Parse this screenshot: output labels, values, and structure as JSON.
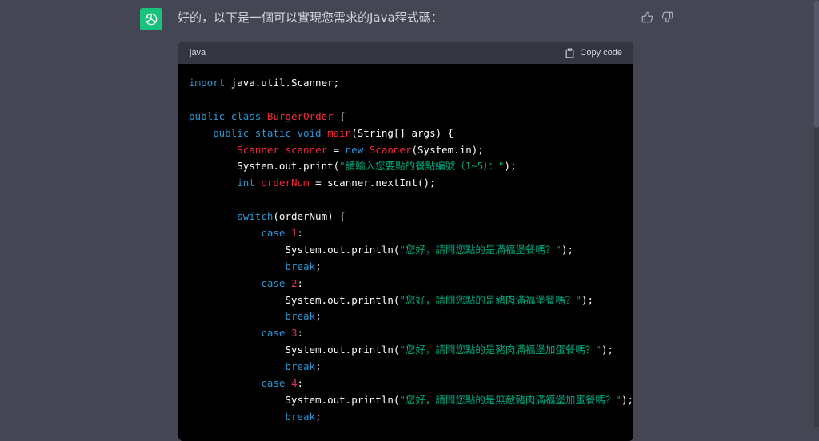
{
  "message": {
    "text": "好的，以下是一個可以實現您需求的Java程式碼："
  },
  "code_block": {
    "language": "java",
    "copy_label": "Copy code",
    "lines": [
      [
        {
          "t": "import",
          "c": "kw"
        },
        {
          "t": " java.util.Scanner;",
          "c": ""
        }
      ],
      [],
      [
        {
          "t": "public",
          "c": "kw"
        },
        {
          "t": " ",
          "c": ""
        },
        {
          "t": "class",
          "c": "kw"
        },
        {
          "t": " ",
          "c": ""
        },
        {
          "t": "BurgerOrder",
          "c": "cls"
        },
        {
          "t": " {",
          "c": ""
        }
      ],
      [
        {
          "t": "    ",
          "c": ""
        },
        {
          "t": "public",
          "c": "kw"
        },
        {
          "t": " ",
          "c": ""
        },
        {
          "t": "static",
          "c": "kw"
        },
        {
          "t": " ",
          "c": ""
        },
        {
          "t": "void",
          "c": "kw"
        },
        {
          "t": " ",
          "c": ""
        },
        {
          "t": "main",
          "c": "fn"
        },
        {
          "t": "(String[] args) {",
          "c": ""
        }
      ],
      [
        {
          "t": "        ",
          "c": ""
        },
        {
          "t": "Scanner",
          "c": "cls"
        },
        {
          "t": " ",
          "c": ""
        },
        {
          "t": "scanner",
          "c": "cls"
        },
        {
          "t": " = ",
          "c": ""
        },
        {
          "t": "new",
          "c": "kw"
        },
        {
          "t": " ",
          "c": ""
        },
        {
          "t": "Scanner",
          "c": "cls"
        },
        {
          "t": "(System.in);",
          "c": ""
        }
      ],
      [
        {
          "t": "        System.out.print(",
          "c": ""
        },
        {
          "t": "\"請輸入您要點的餐點編號（1~5）：\"",
          "c": "str"
        },
        {
          "t": ");",
          "c": ""
        }
      ],
      [
        {
          "t": "        ",
          "c": ""
        },
        {
          "t": "int",
          "c": "kw"
        },
        {
          "t": " ",
          "c": ""
        },
        {
          "t": "orderNum",
          "c": "cls"
        },
        {
          "t": " = scanner.nextInt();",
          "c": ""
        }
      ],
      [],
      [
        {
          "t": "        ",
          "c": ""
        },
        {
          "t": "switch",
          "c": "kw"
        },
        {
          "t": "(orderNum) {",
          "c": ""
        }
      ],
      [
        {
          "t": "            ",
          "c": ""
        },
        {
          "t": "case",
          "c": "kw"
        },
        {
          "t": " ",
          "c": ""
        },
        {
          "t": "1",
          "c": "num"
        },
        {
          "t": ":",
          "c": ""
        }
      ],
      [
        {
          "t": "                System.out.println(",
          "c": ""
        },
        {
          "t": "\"您好，請問您點的是滿福堡餐嗎？\"",
          "c": "str"
        },
        {
          "t": ");",
          "c": ""
        }
      ],
      [
        {
          "t": "                ",
          "c": ""
        },
        {
          "t": "break",
          "c": "kw"
        },
        {
          "t": ";",
          "c": ""
        }
      ],
      [
        {
          "t": "            ",
          "c": ""
        },
        {
          "t": "case",
          "c": "kw"
        },
        {
          "t": " ",
          "c": ""
        },
        {
          "t": "2",
          "c": "num"
        },
        {
          "t": ":",
          "c": ""
        }
      ],
      [
        {
          "t": "                System.out.println(",
          "c": ""
        },
        {
          "t": "\"您好，請問您點的是豬肉滿福堡餐嗎？\"",
          "c": "str"
        },
        {
          "t": ");",
          "c": ""
        }
      ],
      [
        {
          "t": "                ",
          "c": ""
        },
        {
          "t": "break",
          "c": "kw"
        },
        {
          "t": ";",
          "c": ""
        }
      ],
      [
        {
          "t": "            ",
          "c": ""
        },
        {
          "t": "case",
          "c": "kw"
        },
        {
          "t": " ",
          "c": ""
        },
        {
          "t": "3",
          "c": "num"
        },
        {
          "t": ":",
          "c": ""
        }
      ],
      [
        {
          "t": "                System.out.println(",
          "c": ""
        },
        {
          "t": "\"您好，請問您點的是豬肉滿福堡加蛋餐嗎？\"",
          "c": "str"
        },
        {
          "t": ");",
          "c": ""
        }
      ],
      [
        {
          "t": "                ",
          "c": ""
        },
        {
          "t": "break",
          "c": "kw"
        },
        {
          "t": ";",
          "c": ""
        }
      ],
      [
        {
          "t": "            ",
          "c": ""
        },
        {
          "t": "case",
          "c": "kw"
        },
        {
          "t": " ",
          "c": ""
        },
        {
          "t": "4",
          "c": "num"
        },
        {
          "t": ":",
          "c": ""
        }
      ],
      [
        {
          "t": "                System.out.println(",
          "c": ""
        },
        {
          "t": "\"您好，請問您點的是無敵豬肉滿福堡加蛋餐嗎？\"",
          "c": "str"
        },
        {
          "t": ");",
          "c": ""
        }
      ],
      [
        {
          "t": "                ",
          "c": ""
        },
        {
          "t": "break",
          "c": "kw"
        },
        {
          "t": ";",
          "c": ""
        }
      ]
    ]
  },
  "icons": {
    "avatar": "openai-logo-icon",
    "thumbs_up": "thumbs-up-icon",
    "thumbs_down": "thumbs-down-icon",
    "copy": "clipboard-icon"
  },
  "colors": {
    "background": "#444654",
    "code_bg": "#000000",
    "header_bg": "#343541",
    "avatar_bg": "#19c37d",
    "keyword": "#2e95d3",
    "class_name": "#f22c3d",
    "string": "#00a67d",
    "number": "#df3079"
  }
}
